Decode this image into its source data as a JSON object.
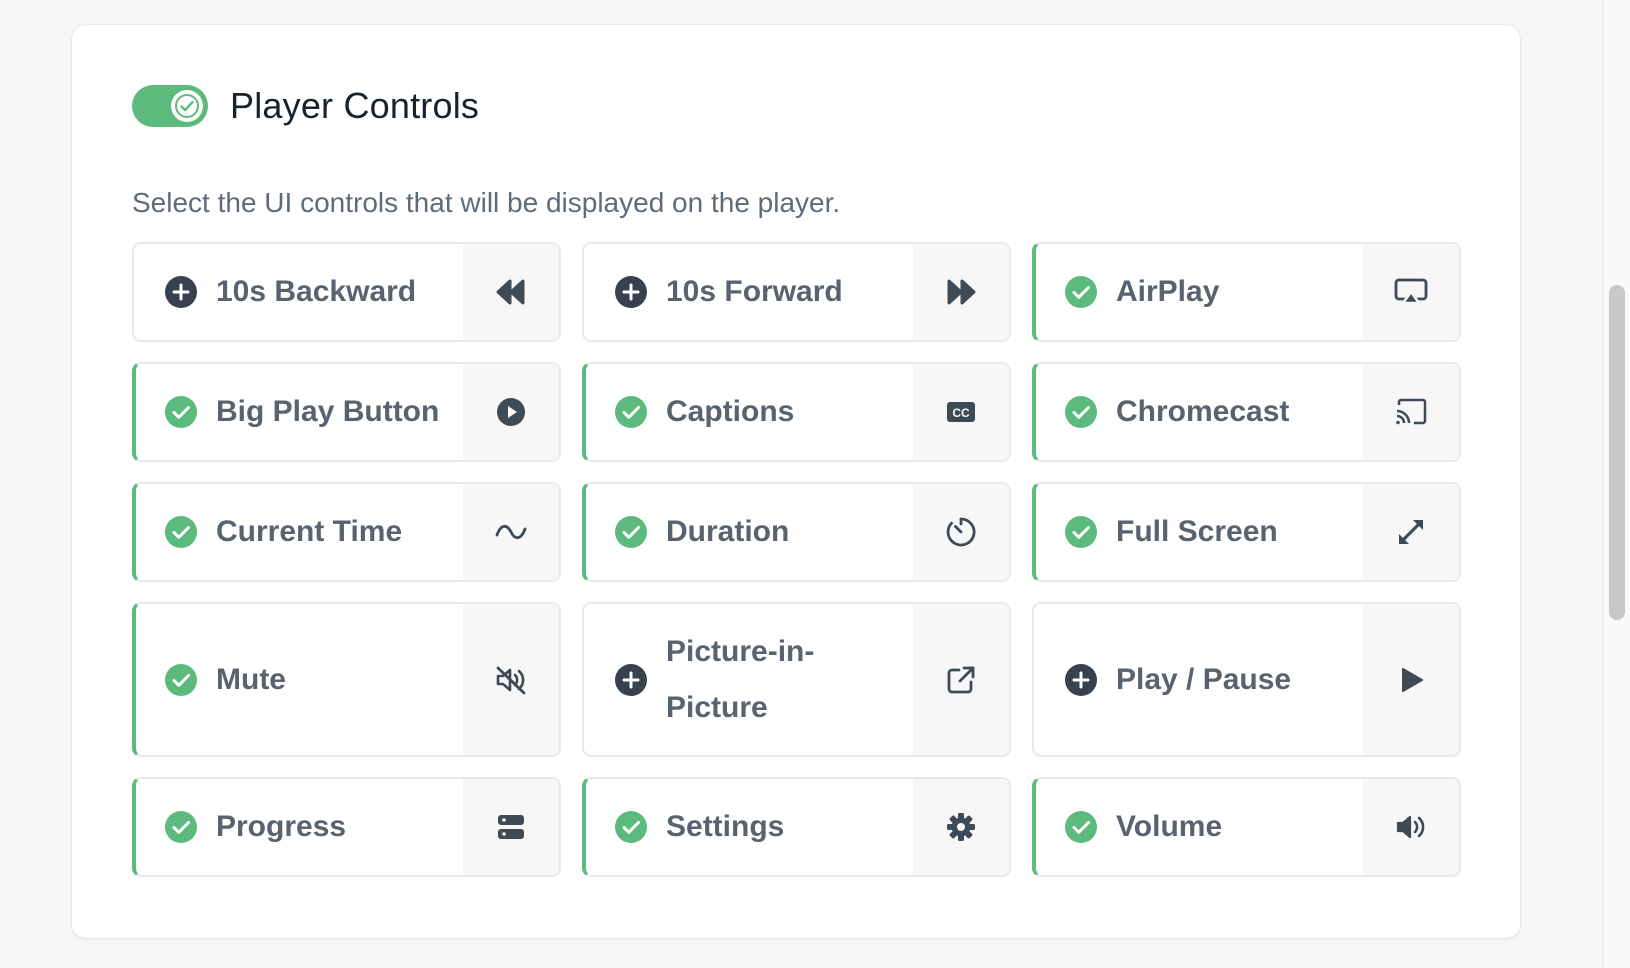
{
  "section": {
    "title": "Player Controls",
    "subtitle": "Select the UI controls that will be displayed on the player.",
    "enabled": true
  },
  "colors": {
    "accent": "#5cba7d",
    "inactive_icon": "#37424f",
    "label": "#58636f"
  },
  "controls": [
    {
      "label": "10s Backward",
      "active": false,
      "icon": "rewind-icon"
    },
    {
      "label": "10s Forward",
      "active": false,
      "icon": "fast-forward-icon"
    },
    {
      "label": "AirPlay",
      "active": true,
      "icon": "airplay-icon"
    },
    {
      "label": "Big Play Button",
      "active": true,
      "icon": "play-circle-icon"
    },
    {
      "label": "Captions",
      "active": true,
      "icon": "closed-captions-icon"
    },
    {
      "label": "Chromecast",
      "active": true,
      "icon": "cast-icon"
    },
    {
      "label": "Current Time",
      "active": true,
      "icon": "tilde-wave-icon"
    },
    {
      "label": "Duration",
      "active": true,
      "icon": "timer-icon"
    },
    {
      "label": "Full Screen",
      "active": true,
      "icon": "expand-icon"
    },
    {
      "label": "Mute",
      "active": true,
      "icon": "volume-mute-icon"
    },
    {
      "label": "Picture-in-Picture",
      "active": false,
      "icon": "external-link-icon"
    },
    {
      "label": "Play / Pause",
      "active": false,
      "icon": "play-icon"
    },
    {
      "label": "Progress",
      "active": true,
      "icon": "progress-bars-icon"
    },
    {
      "label": "Settings",
      "active": true,
      "icon": "gear-icon"
    },
    {
      "label": "Volume",
      "active": true,
      "icon": "volume-icon"
    }
  ]
}
